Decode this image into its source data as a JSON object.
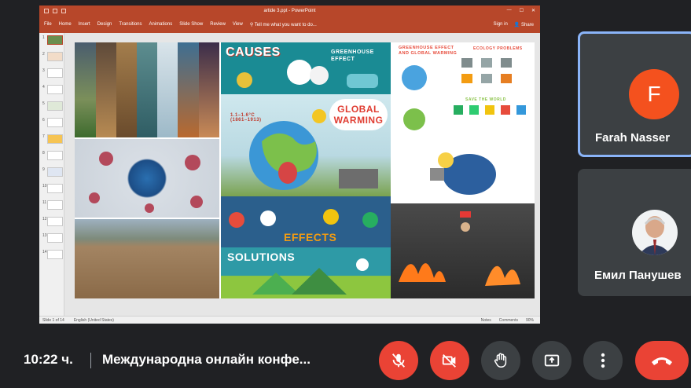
{
  "powerpoint": {
    "title": "artide 3.ppt - PowerPoint",
    "window_controls": [
      "—",
      "☐",
      "✕"
    ],
    "tabs": [
      "File",
      "Home",
      "Insert",
      "Design",
      "Transitions",
      "Animations",
      "Slide Show",
      "Review",
      "View"
    ],
    "tell_me": "Tell me what you want to do...",
    "sign_in": "Sign in",
    "share": "Share",
    "thumbnails": [
      "1",
      "2",
      "3",
      "4",
      "5",
      "6",
      "7",
      "8",
      "9",
      "10",
      "11",
      "12",
      "13",
      "14"
    ],
    "status": {
      "slide_count": "Slide 1 of 14",
      "language": "English (United States)",
      "notes": "Notes",
      "comments": "Comments",
      "zoom": "90%"
    }
  },
  "slide": {
    "causes": "CAUSES",
    "greenhouse_effect": "GREENHOUSE EFFECT",
    "global_warming": "GLOBAL WARMING",
    "temperature_note": "1.1–1.6°C (1861–1913)",
    "infographic_title": "GREENHOUSE EFFECT AND GLOBAL WARMING",
    "ecology_problems": "ECOLOGY PROBLEMS",
    "save_the_world": "SAVE THE WORLD",
    "effects": "EFFECTS",
    "solutions": "SOLUTIONS"
  },
  "participants": [
    {
      "name": "Farah Nasser",
      "initial": "F",
      "color": "#f4511e"
    },
    {
      "name": "Емил Панушев"
    }
  ],
  "bottom_bar": {
    "time": "10:22 ч.",
    "meeting_title": "Международна онлайн конфе...",
    "buttons": [
      "mic-off",
      "camera-off",
      "raise-hand",
      "present",
      "more",
      "leave-call"
    ]
  },
  "colors": {
    "ppt_accent": "#b7472a",
    "meet_bg": "#202124",
    "tile_bg": "#3c4043",
    "danger": "#ea4335",
    "active_border": "#8ab4f8"
  }
}
